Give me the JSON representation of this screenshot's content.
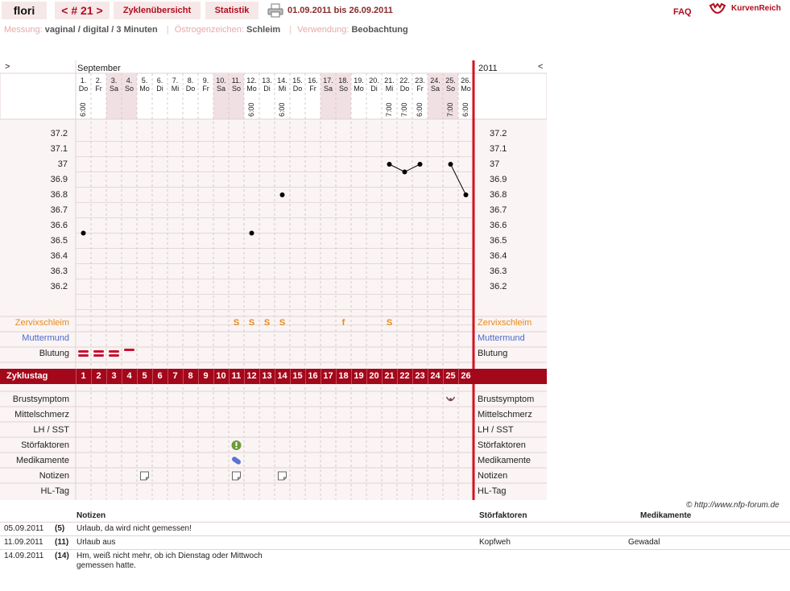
{
  "nav": {
    "user": "flori",
    "cycle": "< # 21 >",
    "overview": "Zyklenübersicht",
    "stats": "Statistik",
    "range": "01.09.2011 bis 26.09.2011",
    "faq": "FAQ",
    "logo": "KurvenReich"
  },
  "meta": {
    "measure_label": "Messung:",
    "measure_value": "vaginal / digital / 3 Minuten",
    "estrogen_label": "Östrogenzeichen:",
    "estrogen_value": "Schleim",
    "use_label": "Verwendung:",
    "use_value": "Beobachtung"
  },
  "chart": {
    "arrow_left": ">",
    "arrow_right": "<",
    "month": "September",
    "year": "2011",
    "days": [
      {
        "d": "1.",
        "w": "Do",
        "t": "6:00",
        "we": false
      },
      {
        "d": "2.",
        "w": "Fr",
        "t": "",
        "we": false
      },
      {
        "d": "3.",
        "w": "Sa",
        "t": "",
        "we": true
      },
      {
        "d": "4.",
        "w": "So",
        "t": "",
        "we": true
      },
      {
        "d": "5.",
        "w": "Mo",
        "t": "",
        "we": false
      },
      {
        "d": "6.",
        "w": "Di",
        "t": "",
        "we": false
      },
      {
        "d": "7.",
        "w": "Mi",
        "t": "",
        "we": false
      },
      {
        "d": "8.",
        "w": "Do",
        "t": "",
        "we": false
      },
      {
        "d": "9.",
        "w": "Fr",
        "t": "",
        "we": false
      },
      {
        "d": "10.",
        "w": "Sa",
        "t": "",
        "we": true
      },
      {
        "d": "11.",
        "w": "So",
        "t": "",
        "we": true
      },
      {
        "d": "12.",
        "w": "Mo",
        "t": "6:00",
        "we": false
      },
      {
        "d": "13.",
        "w": "Di",
        "t": "",
        "we": false
      },
      {
        "d": "14.",
        "w": "Mi",
        "t": "6:00",
        "we": false
      },
      {
        "d": "15.",
        "w": "Do",
        "t": "",
        "we": false
      },
      {
        "d": "16.",
        "w": "Fr",
        "t": "",
        "we": false
      },
      {
        "d": "17.",
        "w": "Sa",
        "t": "",
        "we": true
      },
      {
        "d": "18.",
        "w": "So",
        "t": "",
        "we": true
      },
      {
        "d": "19.",
        "w": "Mo",
        "t": "",
        "we": false
      },
      {
        "d": "20.",
        "w": "Di",
        "t": "",
        "we": false
      },
      {
        "d": "21.",
        "w": "Mi",
        "t": "7:00",
        "we": false
      },
      {
        "d": "22.",
        "w": "Do",
        "t": "7:00",
        "we": false
      },
      {
        "d": "23.",
        "w": "Fr",
        "t": "6:00",
        "we": false
      },
      {
        "d": "24.",
        "w": "Sa",
        "t": "",
        "we": true
      },
      {
        "d": "25.",
        "w": "So",
        "t": "7:00",
        "we": true
      },
      {
        "d": "26.",
        "w": "Mo",
        "t": "6:00",
        "we": false
      }
    ],
    "yticks": [
      "37.2",
      "37.1",
      "37",
      "36.9",
      "36.8",
      "36.7",
      "36.6",
      "36.5",
      "36.4",
      "36.3",
      "36.2"
    ],
    "rows_top": {
      "cervix": "Zervixschleim",
      "os": "Muttermund",
      "bleeding": "Blutung"
    },
    "cycle_label": "Zyklustag",
    "rows_bottom": [
      "Brustsymptom",
      "Mittelschmerz",
      "LH / SST",
      "Störfaktoren",
      "Medikamente",
      "Notizen",
      "HL-Tag"
    ],
    "cervix_marks": {
      "11": "S",
      "12": "S",
      "13": "S",
      "14": "S",
      "18": "f",
      "21": "S"
    },
    "bleeding_days": [
      1,
      2,
      3,
      4
    ],
    "colors": {
      "accent": "#a3081a",
      "divider": "#d6121f",
      "weekend": "#f1e0e3",
      "point": "#000000"
    }
  },
  "chart_data": {
    "type": "line",
    "x": [
      1,
      12,
      14,
      21,
      22,
      23,
      25,
      26
    ],
    "series": [
      {
        "values": [
          36.55,
          36.55,
          36.8,
          37.0,
          36.95,
          37.0,
          37.0,
          36.8
        ]
      }
    ],
    "ylim": [
      36.1,
      37.3
    ],
    "connected_segments": [
      [
        21,
        22,
        23
      ],
      [
        25,
        26
      ]
    ]
  },
  "notes": {
    "copyright": "© http://www.nfp-forum.de",
    "head_notes": "Notizen",
    "head_disturb": "Störfaktoren",
    "head_meds": "Medikamente",
    "rows": [
      {
        "date": "05.09.2011",
        "day": "(5)",
        "note": "Urlaub, da wird nicht gemessen!",
        "disturb": "",
        "meds": ""
      },
      {
        "date": "11.09.2011",
        "day": "(11)",
        "note": "Urlaub aus",
        "disturb": "Kopfweh",
        "meds": "Gewadal"
      },
      {
        "date": "14.09.2011",
        "day": "(14)",
        "note": "Hm, weiß nicht mehr, ob ich Dienstag oder Mittwoch gemessen hatte.",
        "disturb": "",
        "meds": ""
      }
    ]
  }
}
